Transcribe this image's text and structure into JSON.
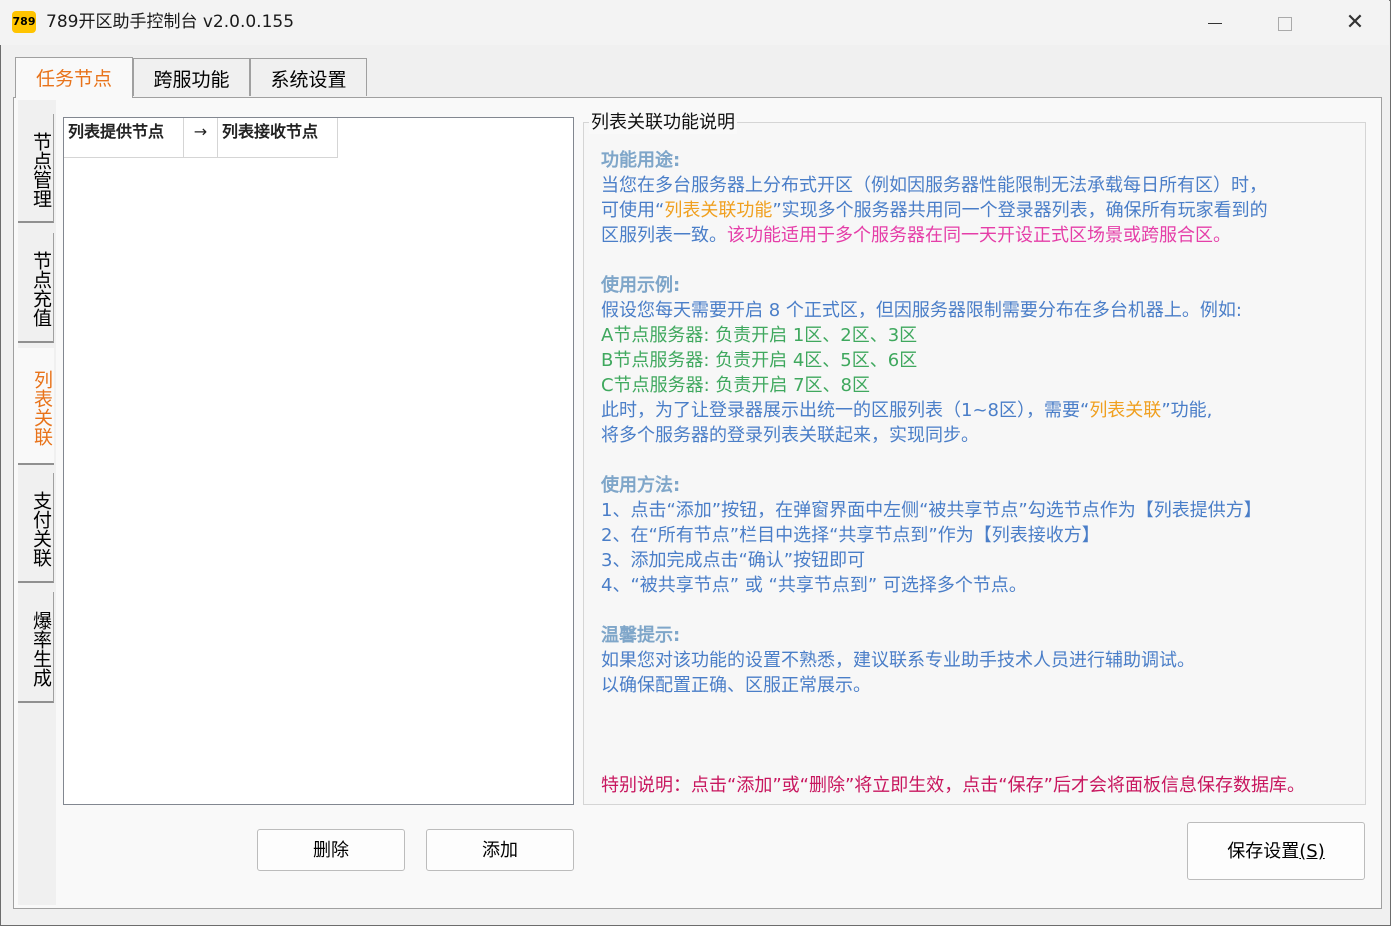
{
  "window": {
    "logo": "789",
    "title": "789开区助手控制台 v2.0.0.155",
    "minimize_icon": "minimize-icon",
    "maximize_icon": "maximize-icon",
    "close_icon": "close-icon",
    "close_glyph": "✕"
  },
  "tabs": [
    {
      "label": "任务节点",
      "active": true
    },
    {
      "label": "跨服功能",
      "active": false
    },
    {
      "label": "系统设置",
      "active": false
    }
  ],
  "side_tabs": [
    {
      "label": "节点管理",
      "active": false
    },
    {
      "label": "节点充值",
      "active": false
    },
    {
      "label": "列表关联",
      "active": true
    },
    {
      "label": "支付关联",
      "active": false
    },
    {
      "label": "爆率生成",
      "active": false
    }
  ],
  "list": {
    "columns": [
      "列表提供节点",
      "→",
      "列表接收节点"
    ],
    "rows": []
  },
  "buttons": {
    "delete": "删除",
    "add": "添加",
    "save": "保存设置",
    "save_mnemonic": "(S)"
  },
  "help": {
    "title": "列表关联功能说明",
    "purpose_heading": "功能用途:",
    "purpose_l1": "当您在多台服务器上分布式开区（例如因服务器性能限制无法承载每日所有区）时，",
    "purpose_l2a": "可使用“",
    "purpose_l2b": "列表关联功能",
    "purpose_l2c": "”实现多个服务器共用同一个登录器列表，确保所有玩家看到的",
    "purpose_l3a": "区服列表一致。",
    "purpose_l3b": "该功能适用于多个服务器在同一天开设正式区场景或跨服合区。",
    "example_heading": "使用示例:",
    "example_l1": "假设您每天需要开启 8 个正式区，但因服务器限制需要分布在多台机器上。例如:",
    "example_a": "A节点服务器:  负责开启 1区、2区、3区",
    "example_b": "B节点服务器:  负责开启 4区、5区、6区",
    "example_c": "C节点服务器:  负责开启 7区、8区",
    "example_l5a": "此时，为了让登录器展示出统一的区服列表（1~8区），需要“",
    "example_l5b": "列表关联",
    "example_l5c": "”功能,",
    "example_l6": "将多个服务器的登录列表关联起来，实现同步。",
    "method_heading": "使用方法:",
    "method_1": "1、点击“添加”按钮，在弹窗界面中左侧“被共享节点”勾选节点作为【列表提供方】",
    "method_2": "2、在“所有节点”栏目中选择“共享节点到”作为【列表接收方】",
    "method_3": "3、添加完成点击“确认”按钮即可",
    "method_4": "4、“被共享节点” 或 “共享节点到” 可选择多个节点。",
    "tips_heading": "温馨提示:",
    "tips_1": "如果您对该功能的设置不熟悉，建议联系专业助手技术人员进行辅助调试。",
    "tips_2": "以确保配置正确、区服正常展示。",
    "special_note": "特别说明：点击“添加”或“删除”将立即生效，点击“保存”后才会将面板信息保存数据库。"
  },
  "colors": {
    "active_tab": "#e8731a",
    "heading": "#7fa6c9",
    "body_text": "#4a7ec8",
    "highlight": "#f0a020",
    "pink": "#e53ea8",
    "green": "#3fa85e",
    "special": "#c8175f",
    "logo_bg": "#ffc400"
  }
}
